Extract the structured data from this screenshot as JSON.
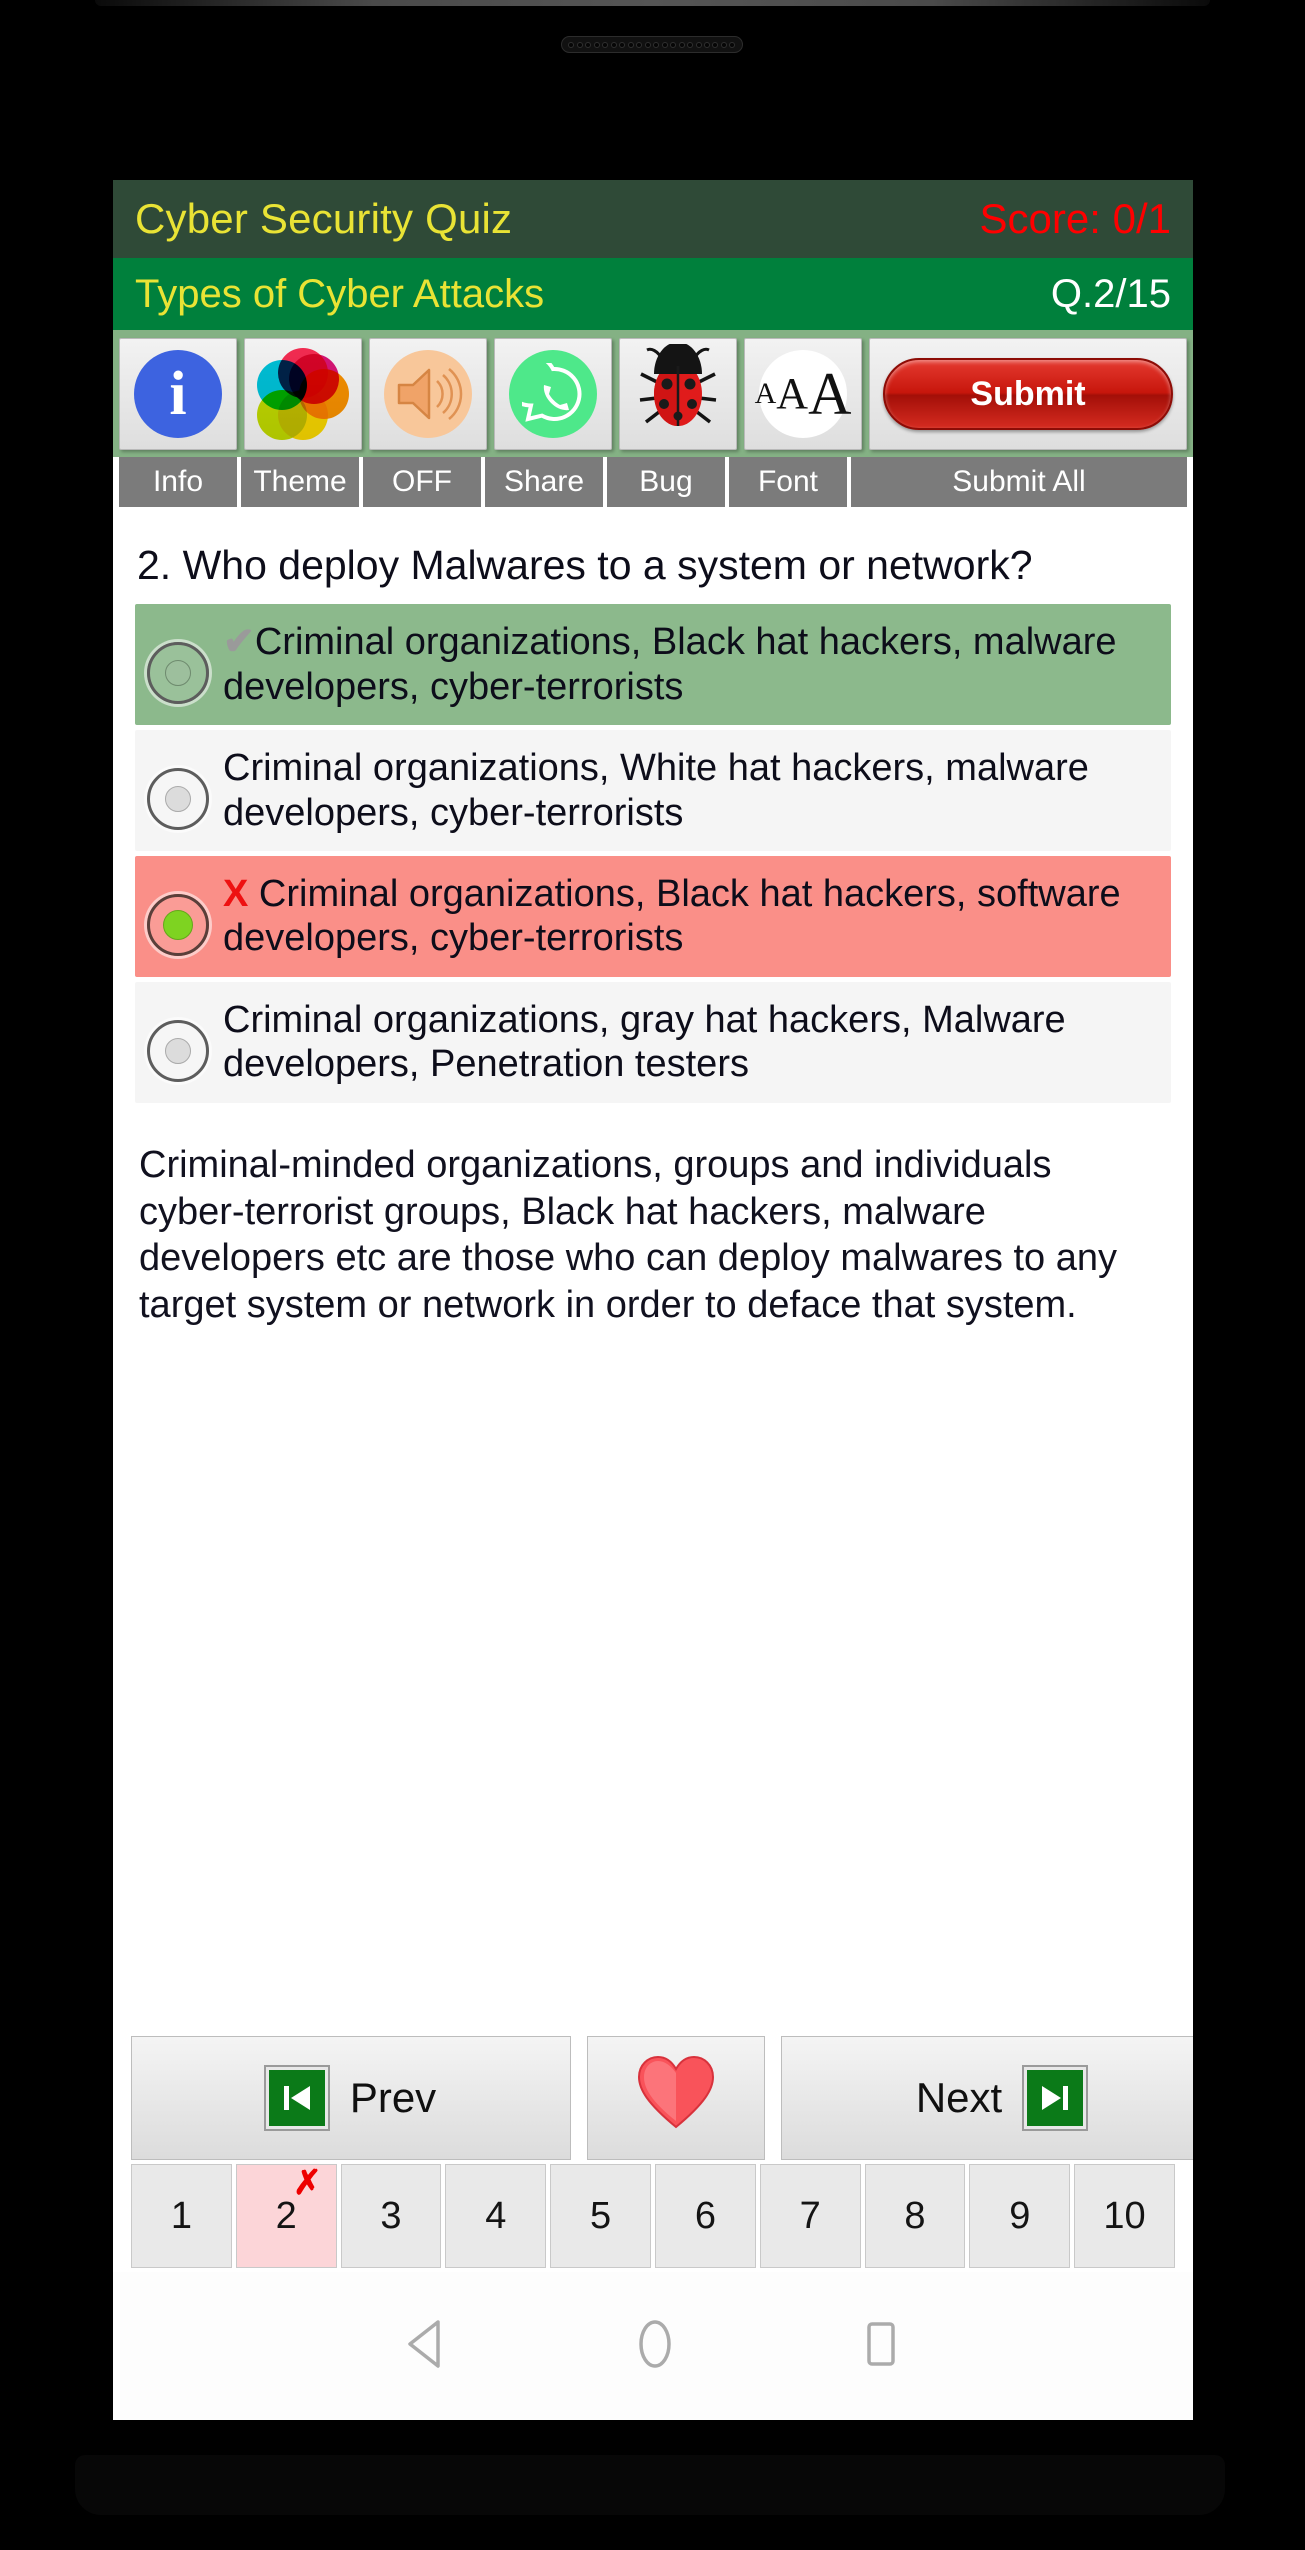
{
  "device": {
    "earpiece_icon": "speaker-grille-icon",
    "nav": {
      "back_icon": "back-triangle-icon",
      "home_icon": "home-circle-icon",
      "recents_icon": "recents-square-icon"
    }
  },
  "header": {
    "app_title": "Cyber Security Quiz",
    "score": "Score: 0/1",
    "category_title": "Types of Cyber Attacks",
    "question_counter": "Q.2/15",
    "title_bg": "#2f4a37",
    "title_fg": "#e9e335",
    "score_fg": "#ff0000",
    "subtitle_bg": "#00803c",
    "counter_fg": "#ffffff"
  },
  "toolbar": {
    "bg": "#84b184",
    "buttons": [
      {
        "label": "Info",
        "icon": "info-icon"
      },
      {
        "label": "Theme",
        "icon": "color-wheel-icon"
      },
      {
        "label": "OFF",
        "icon": "speaker-icon"
      },
      {
        "label": "Share",
        "icon": "whatsapp-icon"
      },
      {
        "label": "Bug",
        "icon": "ladybug-icon"
      },
      {
        "label": "Font",
        "icon": "font-size-icon"
      },
      {
        "label": "Submit All",
        "icon": "submit-pill-icon"
      }
    ],
    "font_icon_text": "ᴀAA",
    "submit_label": "Submit"
  },
  "question": {
    "text": "2. Who deploy Malwares to a system or network?"
  },
  "options": [
    {
      "mark": "✔",
      "mark_type": "tick",
      "text": "Criminal organizations, Black hat hackers, malware developers, cyber-terrorists",
      "state": "correct",
      "selected": false,
      "bg": "#8cb98c"
    },
    {
      "mark": "",
      "mark_type": "none",
      "text": "Criminal organizations, White hat hackers, malware developers, cyber-terrorists",
      "state": "neutral",
      "selected": false,
      "bg": "#f5f5f5"
    },
    {
      "mark": "X",
      "mark_type": "cross",
      "text": "Criminal organizations, Black hat hackers, software developers, cyber-terrorists",
      "state": "wrong",
      "selected": true,
      "bg": "#fa8f88"
    },
    {
      "mark": "",
      "mark_type": "none",
      "text": "Criminal organizations, gray hat hackers, Malware developers, Penetration testers",
      "state": "neutral",
      "selected": false,
      "bg": "#f5f5f5"
    }
  ],
  "explanation": {
    "text": "Criminal-minded organizations, groups and individuals cyber-terrorist groups, Black hat hackers, malware developers etc are those who can deploy malwares to any target system or network in order to deface that system."
  },
  "navigation": {
    "prev_label": "Prev",
    "next_label": "Next",
    "favorite_icon": "heart-icon",
    "prev_icon": "skip-backward-icon",
    "next_icon": "skip-forward-icon"
  },
  "pagination": {
    "pages": [
      "1",
      "2",
      "3",
      "4",
      "5",
      "6",
      "7",
      "8",
      "9",
      "10"
    ],
    "current": "2",
    "current_mark": "✗",
    "current_bg": "#fcd5d8",
    "mark_color": "#ee0000"
  }
}
